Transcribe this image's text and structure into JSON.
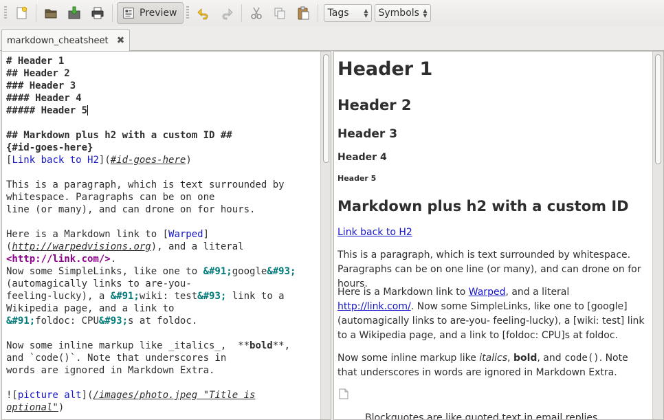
{
  "toolbar": {
    "preview_label": "Preview",
    "tags_label": "Tags",
    "symbols_label": "Symbols"
  },
  "tab": {
    "title": "markdown_cheatsheet"
  },
  "editor": {
    "lines": {
      "h1": "# Header 1",
      "h2": "## Header 2",
      "h3": "### Header 3",
      "h4": "#### Header 4",
      "h5": "##### Header 5",
      "customid_1": "## Markdown plus h2 with a custom ID ##",
      "customid_2": "{#id-goes-here}",
      "link_text": "Link back to H2",
      "link_target": "#id-goes-here",
      "para_1": "This is a paragraph, which is text surrounded by",
      "para_2": "whitespace. Paragraphs can be on one",
      "para_3": "line (or many), and can drone on for hours.",
      "link1_pre": "Here is a Markdown link to [",
      "link1_text": "Warped",
      "link1_url": "http://warpedvisions.org",
      "link1_post": "), and a literal",
      "literal_tag": "<http://link.com/>",
      "simple_1_pre": "Now some SimpleLinks, like one to ",
      "ent_open": "&#91;",
      "ent_close": "&#93;",
      "simple_google": "google",
      "simple_2": "(automagically links to are-you-",
      "simple_3_pre": "feeling-lucky), a ",
      "simple_3_mid": "wiki: test",
      "simple_3_post": " link to a",
      "simple_4": "Wikipedia page, and a link to",
      "simple_5_mid": "foldoc: CPU",
      "simple_5_post": "s at foldoc.",
      "inline_1_pre": "Now some inline markup like _italics_,  **",
      "inline_bold": "bold",
      "inline_1_post": "**,",
      "inline_2": "and `code()`. Note that underscores in",
      "inline_3": "words are ignored in Markdown Extra.",
      "img_alt": "picture alt",
      "img_path_1": "/images/photo.jpeg \"Title is",
      "img_path_2": "optional\""
    }
  },
  "preview": {
    "h1": "Header 1",
    "h2": "Header 2",
    "h3": "Header 3",
    "h4": "Header 4",
    "h5": "Header 5",
    "custom_h2": "Markdown plus h2 with a custom ID",
    "back_link": "Link back to H2",
    "para": "This is a paragraph, which is text surrounded by whitespace. Paragraphs can be on one line (or many), and can drone on for hours.",
    "links_pre": "Here is a Markdown link to ",
    "links_warped": "Warped",
    "links_mid": ", and a literal ",
    "links_literal": "http://link.com/",
    "links_post": ". Now some SimpleLinks, like one to [google] (automagically links to are-you- feeling-lucky), a [wiki: test] link to a Wikipedia page, and a link to [foldoc: CPU]s at foldoc.",
    "inline_pre": "Now some inline markup like ",
    "inline_italics": "italics",
    "inline_sep1": ", ",
    "inline_bold": "bold",
    "inline_sep2": ", and ",
    "inline_code": "code()",
    "inline_post": ". Note that underscores in words are ignored in Markdown Extra.",
    "blockquote": "Blockquotes are like quoted text in email replies"
  }
}
